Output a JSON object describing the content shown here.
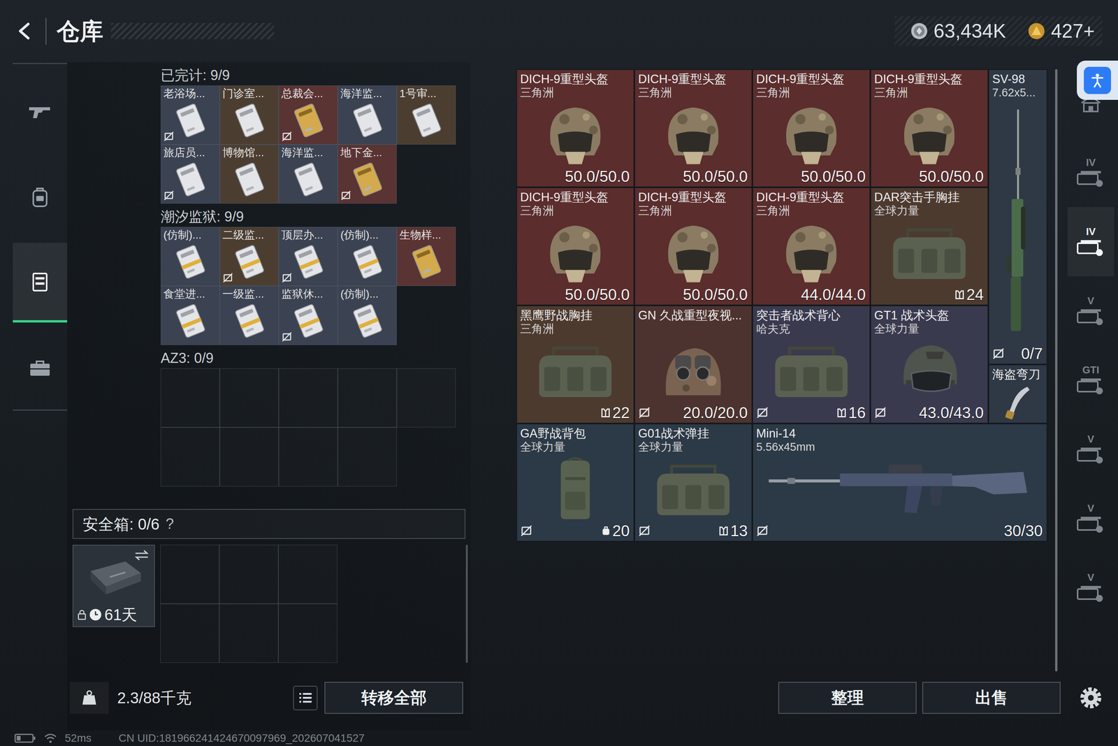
{
  "header": {
    "title": "仓库",
    "currencies": [
      {
        "amount": "63,434K",
        "kind": "silver"
      },
      {
        "amount": "427+",
        "kind": "gold"
      }
    ]
  },
  "left_rail": [
    {
      "kind": "weapons",
      "selected": false
    },
    {
      "kind": "equipment",
      "selected": false
    },
    {
      "kind": "storage",
      "selected": true
    },
    {
      "kind": "cases",
      "selected": false
    }
  ],
  "keycard_groups": [
    {
      "title": "已完计: 9/9",
      "slots": 9,
      "cards": [
        {
          "name": "老浴场...",
          "bound": true,
          "color": "#3b4252",
          "kind": "silver"
        },
        {
          "name": "门诊室...",
          "bound": false,
          "color": "#4b3e31",
          "kind": "silver"
        },
        {
          "name": "总裁会...",
          "bound": true,
          "color": "#5a3333",
          "kind": "gold"
        },
        {
          "name": "海洋监...",
          "bound": false,
          "color": "#3b4252",
          "kind": "silver"
        },
        {
          "name": "1号审...",
          "bound": false,
          "color": "#4b3e31",
          "kind": "silver"
        },
        {
          "name": "旅店员...",
          "bound": true,
          "color": "#3b4252",
          "kind": "silver"
        },
        {
          "name": "博物馆...",
          "bound": false,
          "color": "#4b3e31",
          "kind": "silver"
        },
        {
          "name": "海洋监...",
          "bound": false,
          "color": "#3b4252",
          "kind": "silver"
        },
        {
          "name": "地下金...",
          "bound": true,
          "color": "#5a3333",
          "kind": "gold"
        }
      ]
    },
    {
      "title": "潮汐监狱: 9/9",
      "slots": 9,
      "cards": [
        {
          "name": "(仿制)...",
          "bound": false,
          "color": "#3b4252",
          "kind": "striped"
        },
        {
          "name": "二级监...",
          "bound": true,
          "color": "#4b3e31",
          "kind": "striped"
        },
        {
          "name": "顶层办...",
          "bound": true,
          "color": "#3b4252",
          "kind": "striped"
        },
        {
          "name": "(仿制)...",
          "bound": false,
          "color": "#3b4252",
          "kind": "striped"
        },
        {
          "name": "生物样...",
          "bound": false,
          "color": "#5a3333",
          "kind": "gold"
        },
        {
          "name": "食堂进...",
          "bound": false,
          "color": "#3b4252",
          "kind": "striped"
        },
        {
          "name": "一级监...",
          "bound": false,
          "color": "#3b4252",
          "kind": "striped"
        },
        {
          "name": "监狱休...",
          "bound": true,
          "color": "#3b4252",
          "kind": "striped"
        },
        {
          "name": "(仿制)...",
          "bound": false,
          "color": "#3b4252",
          "kind": "striped"
        }
      ]
    },
    {
      "title": "AZ3: 0/9",
      "slots": 9,
      "cards": []
    }
  ],
  "safe_box": {
    "label": "安全箱: 0/6",
    "help": "?",
    "timer": "61天",
    "locked": true,
    "slots": 6
  },
  "inventory_footer": {
    "weight": "2.3/88千克",
    "transfer": "转移全部"
  },
  "items": [
    {
      "name": "DICH-9重型头盔",
      "sub": "三角洲",
      "value": "50.0/50.0",
      "bound": false,
      "color": "#5b2d2d",
      "kind": "helmet-heavy"
    },
    {
      "name": "DICH-9重型头盔",
      "sub": "三角洲",
      "value": "50.0/50.0",
      "bound": false,
      "color": "#5b2d2d",
      "kind": "helmet-heavy"
    },
    {
      "name": "DICH-9重型头盔",
      "sub": "三角洲",
      "value": "50.0/50.0",
      "bound": false,
      "color": "#5b2d2d",
      "kind": "helmet-heavy"
    },
    {
      "name": "DICH-9重型头盔",
      "sub": "三角洲",
      "value": "50.0/50.0",
      "bound": false,
      "color": "#5b2d2d",
      "kind": "helmet-heavy"
    },
    {
      "name": "SV-98",
      "sub": "7.62x5...",
      "value": "0/7",
      "bound": true,
      "color": "#2f3945",
      "kind": "rifle-long"
    },
    {
      "name": "DICH-9重型头盔",
      "sub": "三角洲",
      "value": "50.0/50.0",
      "bound": false,
      "color": "#5b2d2d",
      "kind": "helmet-heavy"
    },
    {
      "name": "DICH-9重型头盔",
      "sub": "三角洲",
      "value": "50.0/50.0",
      "bound": false,
      "color": "#5b2d2d",
      "kind": "helmet-heavy"
    },
    {
      "name": "DICH-9重型头盔",
      "sub": "三角洲",
      "value": "44.0/44.0",
      "bound": false,
      "color": "#5b2d2d",
      "kind": "helmet-heavy"
    },
    {
      "name": "DAR突击手胸挂",
      "sub": "全球力量",
      "value": "24",
      "bound": false,
      "color": "#4d3a2f",
      "kind": "vest"
    },
    {
      "name": "黑鹰野战胸挂",
      "sub": "三角洲",
      "value": "22",
      "bound": false,
      "color": "#4d3a2f",
      "kind": "vest"
    },
    {
      "name": "GN 久战重型夜视...",
      "value": "20.0/20.0",
      "bound": true,
      "color": "#4d3330",
      "kind": "helmet-nvg"
    },
    {
      "name": "突击者战术背心",
      "sub": "哈夫克",
      "value": "16",
      "bound": true,
      "color": "#3a3a4f",
      "kind": "vest"
    },
    {
      "name": "GT1 战术头盔",
      "sub": "全球力量",
      "value": "43.0/43.0",
      "bound": true,
      "color": "#3a3a4f",
      "kind": "helmet-tac"
    },
    {
      "name": "海盗弯刀",
      "bound": false,
      "color": "#2f3945",
      "kind": "melee"
    },
    {
      "name": "GA野战背包",
      "sub": "全球力量",
      "value": "20",
      "bound": true,
      "color": "#2c3947",
      "kind": "backpack"
    },
    {
      "name": "G01战术弹挂",
      "sub": "全球力量",
      "value": "13",
      "bound": true,
      "color": "#2c3947",
      "kind": "vest"
    },
    {
      "name": "Mini-14",
      "sub": "5.56x45mm",
      "value": "30/30",
      "bound": true,
      "color": "#2c3947",
      "kind": "rifle"
    }
  ],
  "actions": [
    "整理",
    "出售"
  ],
  "right_rail": [
    {
      "kind": "home",
      "selected": false
    },
    {
      "kind": "tier",
      "label": "IV",
      "selected": false
    },
    {
      "kind": "tier",
      "label": "IV",
      "selected": true
    },
    {
      "kind": "tier",
      "label": "V",
      "selected": false
    },
    {
      "kind": "tier",
      "label": "GTI",
      "selected": false
    },
    {
      "kind": "tier",
      "label": "V",
      "selected": false
    },
    {
      "kind": "tier",
      "label": "V",
      "selected": false
    },
    {
      "kind": "tier",
      "label": "V",
      "selected": false
    }
  ],
  "status": {
    "ping": "52ms",
    "uid": "CN UID:181966241424670097969_202607041527"
  }
}
